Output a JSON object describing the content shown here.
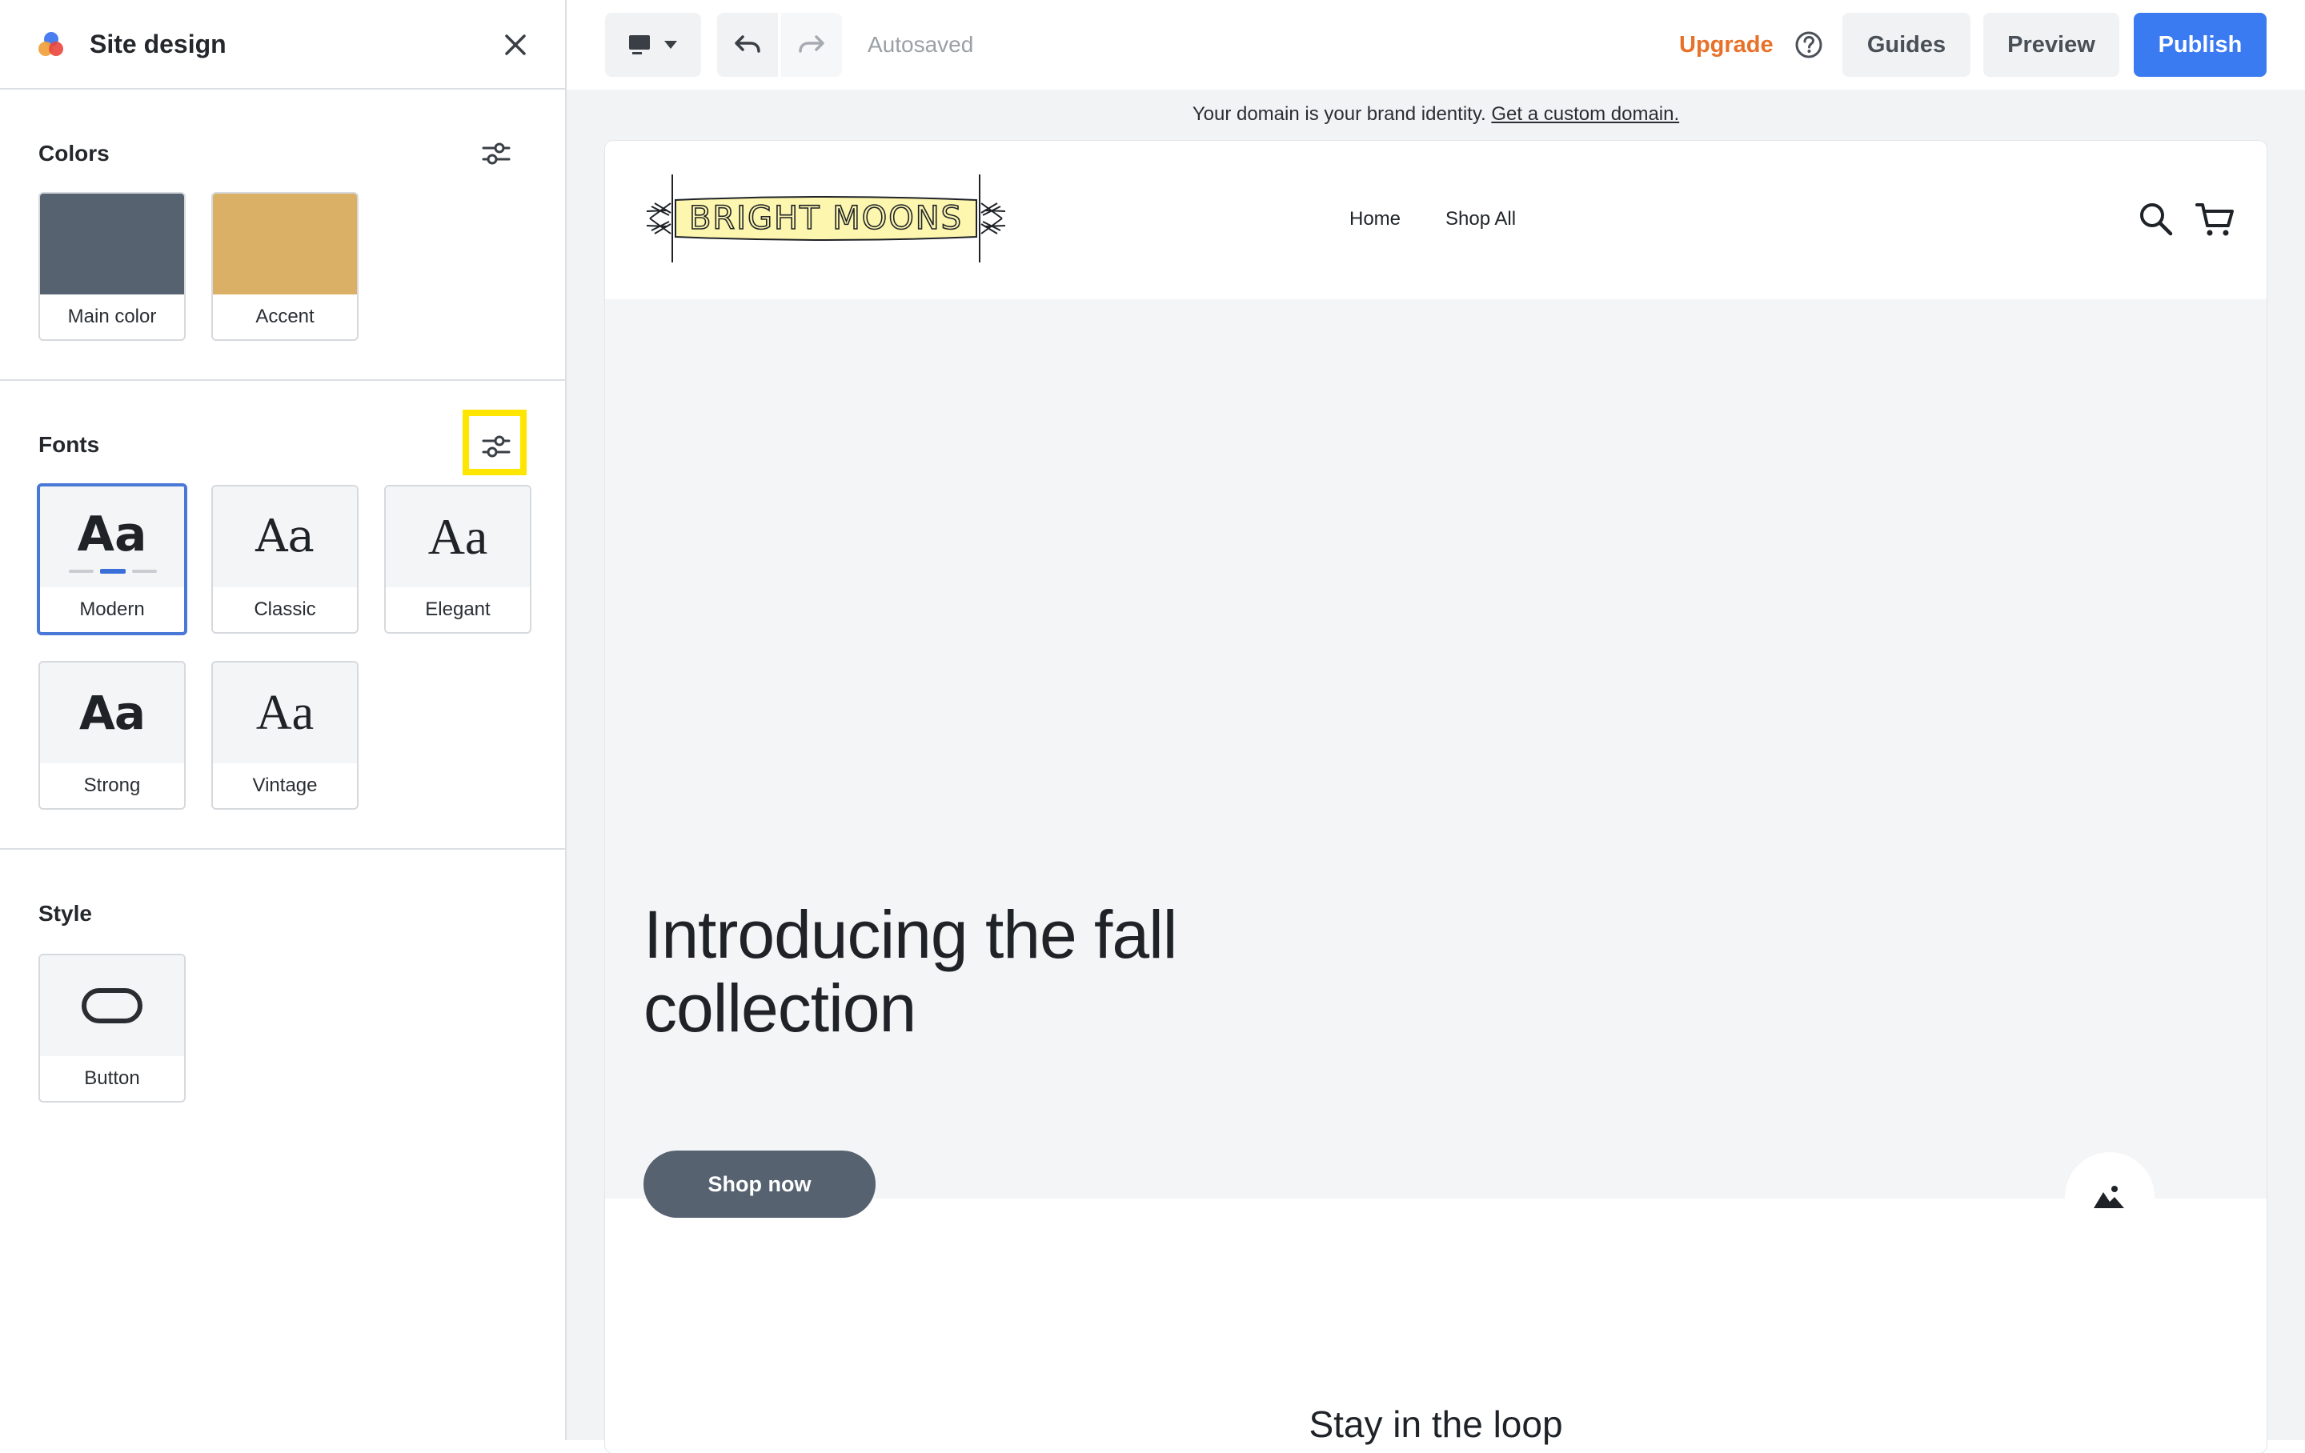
{
  "panel": {
    "title": "Site design",
    "colors": {
      "title": "Colors",
      "items": [
        {
          "label": "Main color",
          "swatch": "#566270"
        },
        {
          "label": "Accent",
          "swatch": "#d9b066"
        }
      ]
    },
    "fonts": {
      "title": "Fonts",
      "sample": "Aa",
      "items": [
        {
          "label": "Modern",
          "selected": true
        },
        {
          "label": "Classic"
        },
        {
          "label": "Elegant"
        },
        {
          "label": "Strong"
        },
        {
          "label": "Vintage"
        }
      ]
    },
    "style": {
      "title": "Style",
      "items": [
        {
          "label": "Button"
        }
      ]
    }
  },
  "toolbar": {
    "autosaved": "Autosaved",
    "upgrade": "Upgrade",
    "guides": "Guides",
    "preview": "Preview",
    "publish": "Publish"
  },
  "banner": {
    "text": "Your domain is your brand identity. ",
    "link": "Get a custom domain."
  },
  "site": {
    "logo_text": "BRIGHT MOONS",
    "nav": [
      "Home",
      "Shop All"
    ],
    "hero_title": "Introducing the fall collection",
    "hero_button": "Shop now",
    "stay": "Stay in the loop"
  },
  "colors": {
    "publish": "#3b7bf1",
    "upgrade": "#e8712a",
    "highlight": "#ffe600",
    "selected_border": "#4a78d6"
  }
}
